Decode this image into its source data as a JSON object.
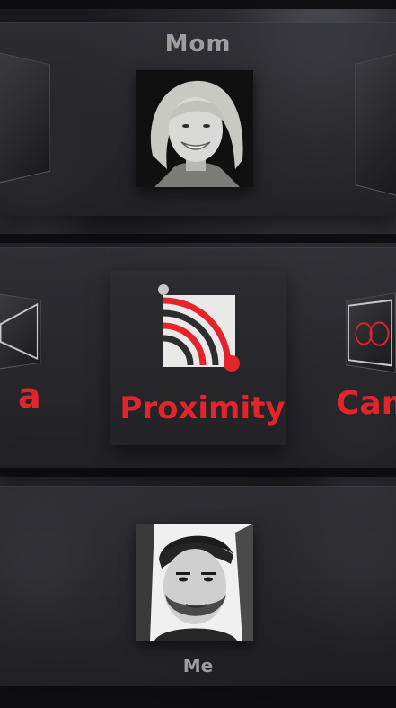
{
  "contacts": {
    "top_name": "Mom",
    "bottom_name": "Me"
  },
  "mode": {
    "center_label": "Proximity",
    "left_partial": "a",
    "right_partial": "Cam"
  },
  "icons": {
    "proximity": "proximity-wifi-icon",
    "camera": "camera-icon",
    "left_device": "device-icon"
  },
  "colors": {
    "accent": "#e3242b",
    "label_grey": "#9d9d9d"
  }
}
